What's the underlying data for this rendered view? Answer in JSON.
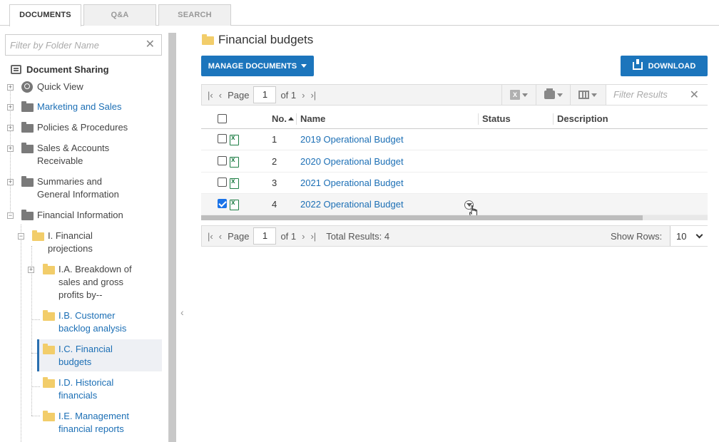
{
  "tabs": [
    {
      "label": "DOCUMENTS",
      "active": true
    },
    {
      "label": "Q&A",
      "active": false
    },
    {
      "label": "SEARCH",
      "active": false
    }
  ],
  "sidebar": {
    "filter_placeholder": "Filter by Folder Name",
    "root_label": "Document Sharing",
    "items": {
      "quick_view": "Quick View",
      "marketing": "Marketing and Sales",
      "policies": "Policies & Procedures",
      "sales_line1": "Sales & Accounts",
      "sales_line2": "Receivable",
      "summaries_line1": "Summaries and",
      "summaries_line2": "General Information",
      "financial_info": "Financial Information",
      "projections_line1": "I. Financial",
      "projections_line2": "projections",
      "breakdown_line1": "I.A. Breakdown of",
      "breakdown_line2": "sales and gross",
      "breakdown_line3": "profits by--",
      "backlog_line1": "I.B. Customer",
      "backlog_line2": "backlog analysis",
      "budgets_line1": "I.C. Financial",
      "budgets_line2": "budgets",
      "historical_line1": "I.D. Historical",
      "historical_line2": "financials",
      "mgmt_line1": "I.E. Management",
      "mgmt_line2": "financial reports"
    },
    "selected_item": "I.C. Financial budgets"
  },
  "main": {
    "title": "Financial budgets",
    "manage_label": "MANAGE DOCUMENTS",
    "download_label": "DOWNLOAD",
    "pager": {
      "page_label": "Page",
      "page": "1",
      "of_label": "of 1"
    },
    "filter_placeholder": "Filter Results",
    "columns": {
      "no": "No.",
      "name": "Name",
      "status": "Status",
      "description": "Description"
    },
    "rows": [
      {
        "no": "1",
        "name": "2019 Operational Budget",
        "checked": false
      },
      {
        "no": "2",
        "name": "2020 Operational Budget",
        "checked": false
      },
      {
        "no": "3",
        "name": "2021 Operational Budget",
        "checked": false
      },
      {
        "no": "4",
        "name": "2022 Operational Budget",
        "checked": true
      }
    ],
    "footer": {
      "page_label": "Page",
      "page": "1",
      "of_label": "of 1",
      "total": "Total Results: 4",
      "show_rows_label": "Show Rows:",
      "rows_value": "10"
    }
  },
  "icons": {
    "root": "list-icon",
    "quick_view": "search-icon",
    "folder": "folder-icon",
    "download": "download-icon",
    "excel": "excel-icon",
    "print": "print-icon",
    "columns": "columns-icon"
  },
  "colors": {
    "accent": "#1c75bc",
    "link": "#1c6fb5",
    "folder_yellow": "#f2cd6a",
    "folder_gray": "#7a7a7a"
  }
}
